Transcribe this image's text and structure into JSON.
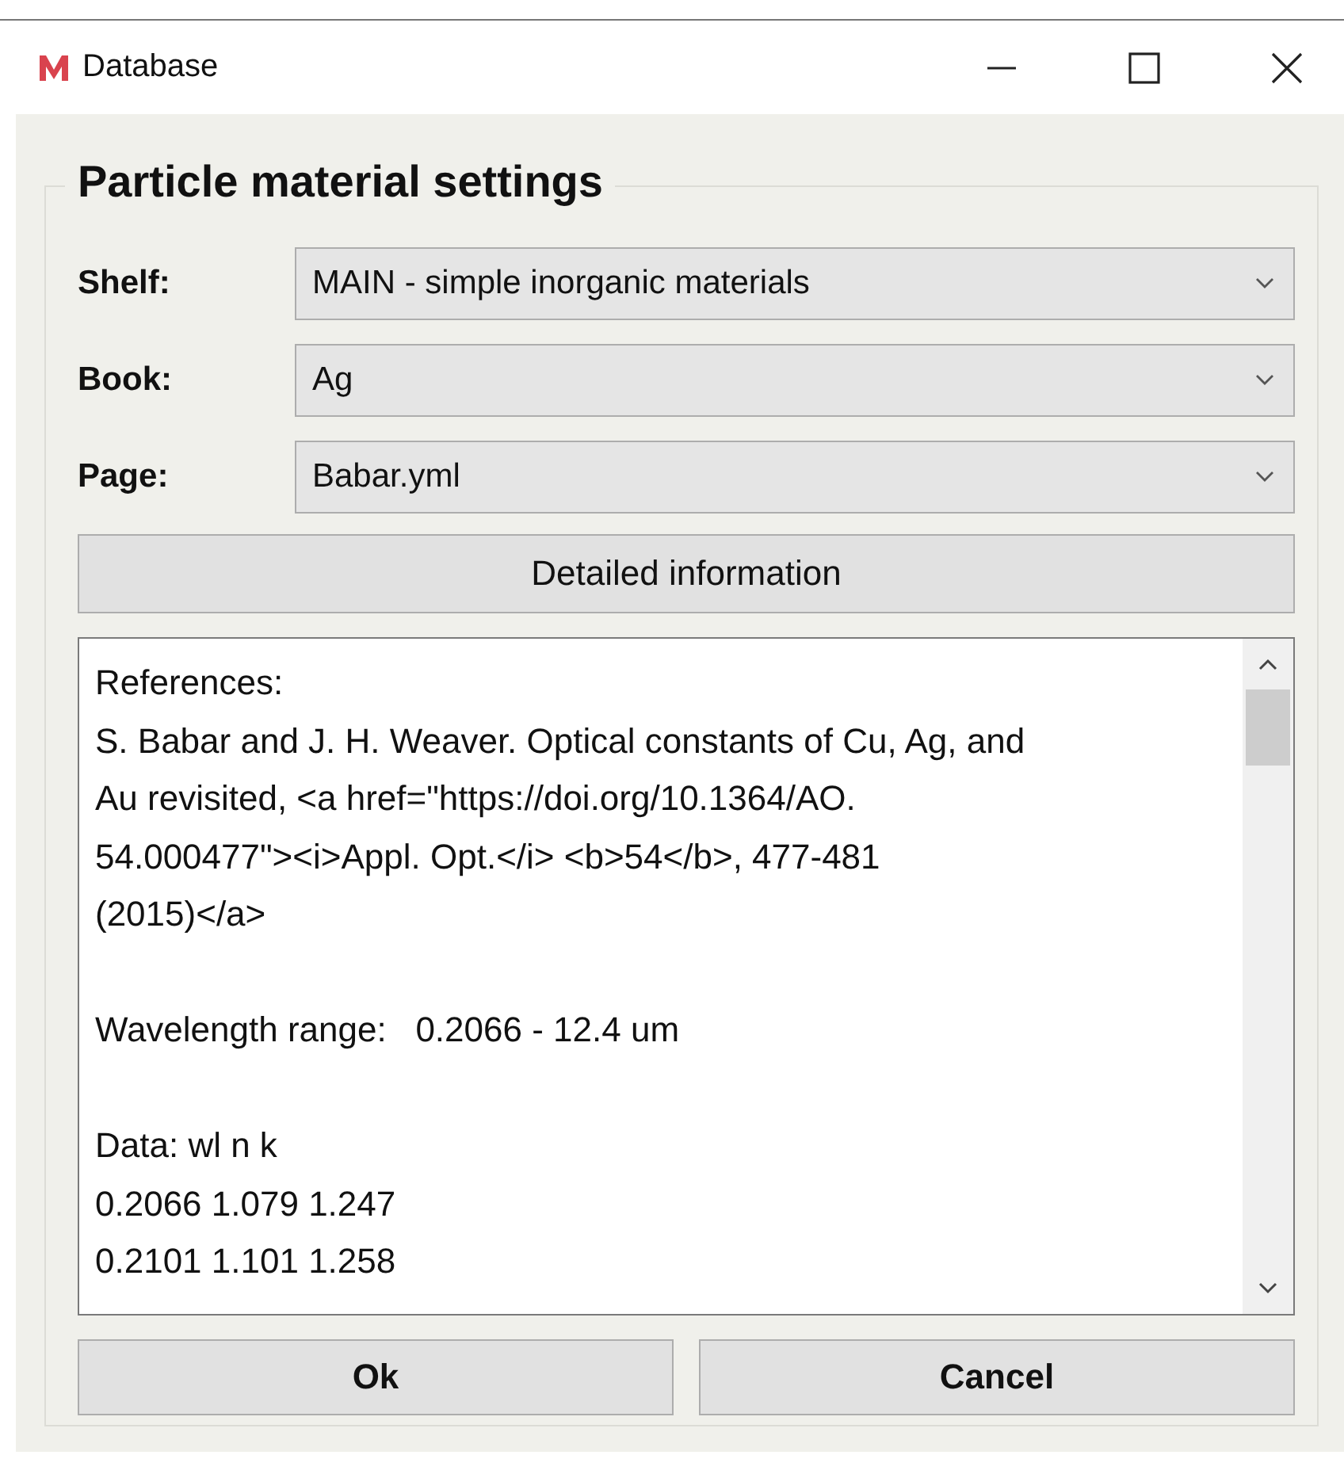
{
  "window": {
    "title": "Database"
  },
  "group": {
    "title": "Particle material settings"
  },
  "fields": [
    {
      "label": "Shelf:",
      "value": "MAIN - simple inorganic materials"
    },
    {
      "label": "Book:",
      "value": "Ag"
    },
    {
      "label": "Page:",
      "value": "Babar.yml"
    }
  ],
  "details_button": "Detailed information",
  "info_text": {
    "paragraphs": [
      [
        "References:",
        "S. Babar and J. H. Weaver. Optical constants of Cu, Ag, and",
        "Au revisited, <a href=\"https://doi.org/10.1364/AO.",
        "54.000477\"><i>Appl. Opt.</i> <b>54</b>, 477-481",
        "(2015)</a>"
      ],
      [
        "Wavelength range:   0.2066 - 12.4 um"
      ],
      [
        "Data: wl n k",
        "0.2066 1.079 1.247",
        "0.2101 1.101 1.258"
      ]
    ]
  },
  "buttons": [
    "Ok",
    "Cancel"
  ]
}
